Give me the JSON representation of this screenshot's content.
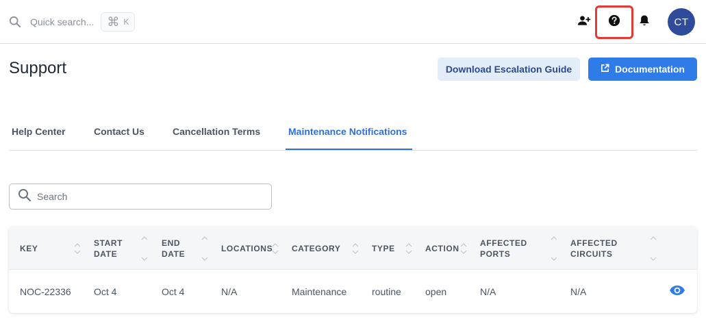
{
  "topbar": {
    "search_placeholder": "Quick search...",
    "shortcut_symbol": "⌘",
    "shortcut_key": "K",
    "avatar_initials": "CT",
    "icons": [
      "search-icon",
      "add-user-icon",
      "help-icon",
      "bell-icon"
    ]
  },
  "header": {
    "title": "Support",
    "secondary_button": "Download Escalation Guide",
    "primary_button": "Documentation"
  },
  "tabs": [
    {
      "label": "Help Center",
      "active": false
    },
    {
      "label": "Contact Us",
      "active": false
    },
    {
      "label": "Cancellation Terms",
      "active": false
    },
    {
      "label": "Maintenance Notifications",
      "active": true
    }
  ],
  "search": {
    "placeholder": "Search"
  },
  "table": {
    "columns": [
      {
        "line1": "KEY",
        "line2": ""
      },
      {
        "line1": "START",
        "line2": "DATE"
      },
      {
        "line1": "END",
        "line2": "DATE"
      },
      {
        "line1": "LOCATIONS",
        "line2": ""
      },
      {
        "line1": "CATEGORY",
        "line2": ""
      },
      {
        "line1": "TYPE",
        "line2": ""
      },
      {
        "line1": "ACTION",
        "line2": ""
      },
      {
        "line1": "AFFECTED",
        "line2": "PORTS"
      },
      {
        "line1": "AFFECTED",
        "line2": "CIRCUITS"
      }
    ],
    "rows": [
      [
        "NOC-22336",
        "Oct 4",
        "Oct 4",
        "N/A",
        "Maintenance",
        "routine",
        "open",
        "N/A",
        "N/A"
      ]
    ]
  },
  "colors": {
    "primary": "#2f7be8",
    "active_tab": "#2f6fd6",
    "avatar": "#2f4b9a",
    "highlight": "#e53935"
  }
}
